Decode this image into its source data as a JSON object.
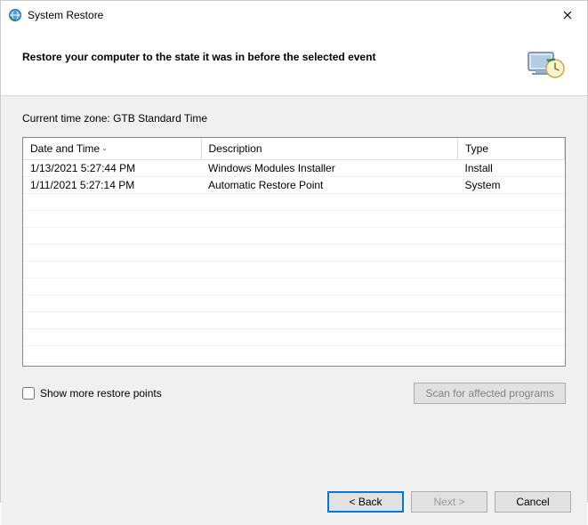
{
  "window": {
    "title": "System Restore"
  },
  "header": {
    "headline": "Restore your computer to the state it was in before the selected event"
  },
  "timezone": {
    "label": "Current time zone:",
    "value": "GTB Standard Time"
  },
  "columns": {
    "date": "Date and Time",
    "description": "Description",
    "type": "Type"
  },
  "rows": [
    {
      "date": "1/13/2021 5:27:44 PM",
      "description": "Windows Modules Installer",
      "type": "Install"
    },
    {
      "date": "1/11/2021 5:27:14 PM",
      "description": "Automatic Restore Point",
      "type": "System"
    }
  ],
  "checkbox": {
    "label": "Show more restore points",
    "checked": false
  },
  "buttons": {
    "scan": "Scan for affected programs",
    "back": "< Back",
    "next": "Next >",
    "cancel": "Cancel"
  }
}
